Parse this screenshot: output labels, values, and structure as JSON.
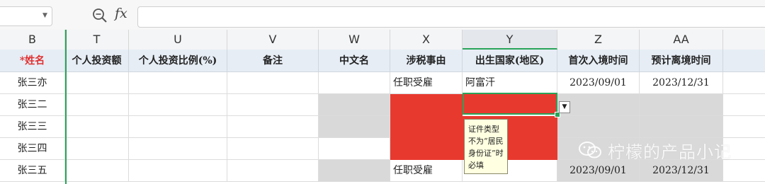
{
  "formula_bar": {
    "name_box": "",
    "fx_label": "fx",
    "formula": ""
  },
  "columns": [
    {
      "letter": "B",
      "header": "*姓名"
    },
    {
      "letter": "T",
      "header": "个人投资额"
    },
    {
      "letter": "U",
      "header": "个人投资比例(%)"
    },
    {
      "letter": "V",
      "header": "备注"
    },
    {
      "letter": "W",
      "header": "中文名"
    },
    {
      "letter": "X",
      "header": "涉税事由"
    },
    {
      "letter": "Y",
      "header": "出生国家(地区)"
    },
    {
      "letter": "Z",
      "header": "首次入境时间"
    },
    {
      "letter": "AA",
      "header": "预计离境时间"
    }
  ],
  "active_column": "Y",
  "rows": [
    {
      "name": "张三亦",
      "reason": "任职受雇",
      "country": "阿富汗",
      "entry": "2023/09/01",
      "exit": "2023/12/31"
    },
    {
      "name": "张三二",
      "reason": "",
      "country": "",
      "entry": "",
      "exit": ""
    },
    {
      "name": "张三三",
      "reason": "",
      "country": "",
      "entry": "",
      "exit": ""
    },
    {
      "name": "张三四",
      "reason": "",
      "country": "",
      "entry": "",
      "exit": ""
    },
    {
      "name": "张三五",
      "reason": "任职受雇",
      "country": "",
      "entry": "2023/09/01",
      "exit": "2023/12/31"
    }
  ],
  "tooltip": {
    "lines": [
      "证件类型",
      "不为“居民",
      "身份证”时",
      "必填"
    ]
  },
  "watermark": {
    "text": "柠檬的产品小记",
    "icon": "wechat-icon"
  },
  "colors": {
    "error_fill": "#e8392f",
    "disabled_fill": "#d9d9d9",
    "header_fill": "#e6edf5",
    "selection": "#2aa35a",
    "required_text": "#e03030"
  }
}
